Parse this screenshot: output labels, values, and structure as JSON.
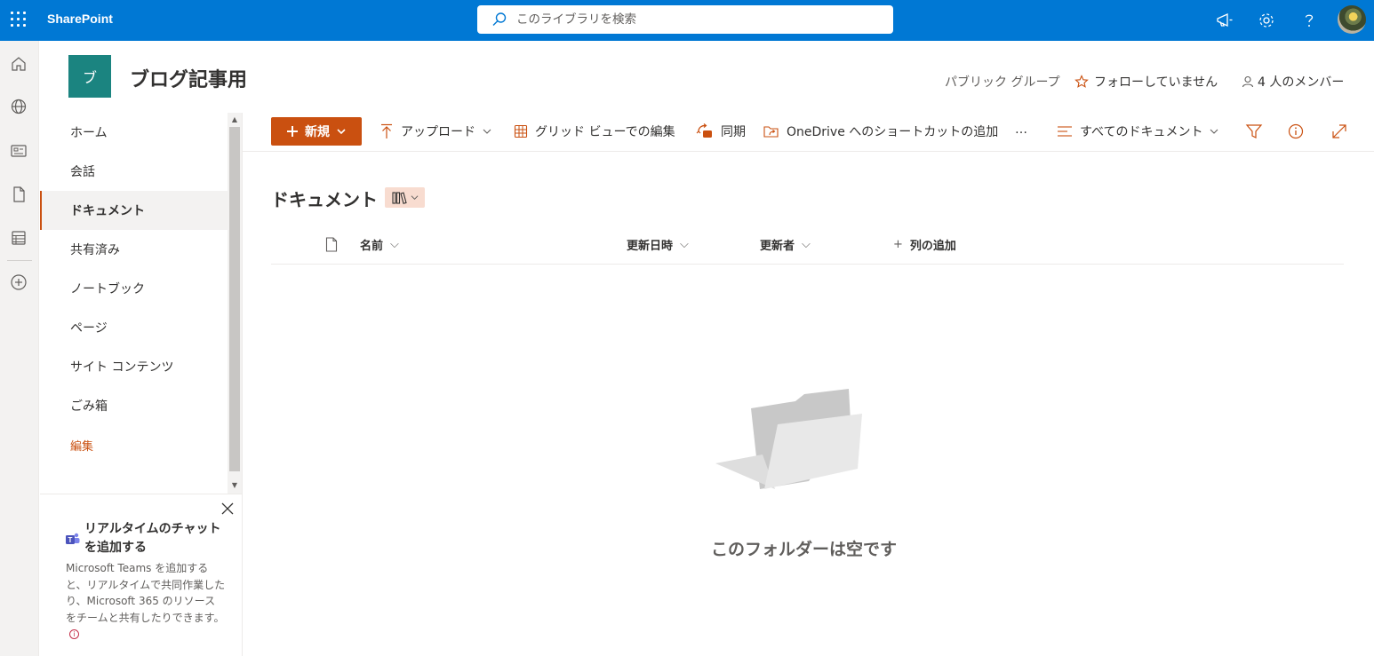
{
  "suite": {
    "brand": "SharePoint",
    "search_placeholder": "このライブラリを検索",
    "icons": [
      "waffle-icon",
      "megaphone-icon",
      "gear-icon",
      "help-icon",
      "avatar"
    ],
    "accent_color": "#0078d4"
  },
  "site": {
    "logo_letter": "ブ",
    "logo_color": "#1b8480",
    "title": "ブログ記事用",
    "group_type": "パブリック グループ",
    "follow_label": "フォローしていません",
    "members_label": "4 人のメンバー"
  },
  "nav": {
    "items": [
      {
        "label": "ホーム"
      },
      {
        "label": "会話"
      },
      {
        "label": "ドキュメント",
        "selected": true
      },
      {
        "label": "共有済み"
      },
      {
        "label": "ノートブック"
      },
      {
        "label": "ページ"
      },
      {
        "label": "サイト コンテンツ"
      },
      {
        "label": "ごみ箱"
      }
    ],
    "edit_label": "編集"
  },
  "promo": {
    "title": "リアルタイムのチャットを追加する",
    "text": "Microsoft Teams を追加すると、リアルタイムで共同作業したり、Microsoft 365 のリソースをチームと共有したりできます。"
  },
  "commands": {
    "new_label": "新規",
    "upload_label": "アップロード",
    "grid_edit_label": "グリッド ビューでの編集",
    "sync_label": "同期",
    "onedrive_label": "OneDrive へのショートカットの追加",
    "more_label": "…",
    "view_label": "すべてのドキュメント",
    "accent_color": "#ca5010"
  },
  "library": {
    "title": "ドキュメント",
    "columns": {
      "name": "名前",
      "modified": "更新日時",
      "modified_by": "更新者",
      "add_column": "列の追加"
    },
    "empty_message": "このフォルダーは空です"
  }
}
